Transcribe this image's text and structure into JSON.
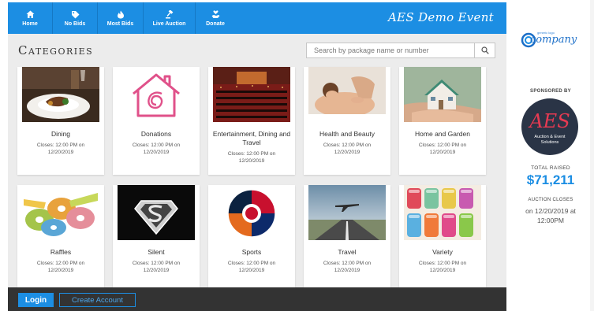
{
  "nav": {
    "items": [
      {
        "label": "Home",
        "icon": "home-icon"
      },
      {
        "label": "No Bids",
        "icon": "tag-icon"
      },
      {
        "label": "Most Bids",
        "icon": "fire-icon"
      },
      {
        "label": "Live Auction",
        "icon": "gavel-icon"
      },
      {
        "label": "Donate",
        "icon": "heart-hand-icon"
      }
    ],
    "event_title": "AES Demo Event"
  },
  "header": {
    "title": "Categories",
    "search_placeholder": "Search by package name or number"
  },
  "categories": [
    {
      "name": "Dining",
      "closes": "Closes: 12:00 PM on 12/20/2019"
    },
    {
      "name": "Donations",
      "closes": "Closes: 12:00 PM on 12/20/2019"
    },
    {
      "name": "Entertainment, Dining and Travel",
      "closes": "Closes: 12:00 PM on 12/20/2019"
    },
    {
      "name": "Health and Beauty",
      "closes": "Closes: 12:00 PM on 12/20/2019"
    },
    {
      "name": "Home and Garden",
      "closes": "Closes: 12:00 PM on 12/20/2019"
    },
    {
      "name": "Raffles",
      "closes": "Closes: 12:00 PM on 12/20/2019"
    },
    {
      "name": "Silent",
      "closes": "Closes: 12:00 PM on 12/20/2019"
    },
    {
      "name": "Sports",
      "closes": "Closes: 12:00 PM on 12/20/2019"
    },
    {
      "name": "Travel",
      "closes": "Closes: 12:00 PM on 12/20/2019"
    },
    {
      "name": "Variety",
      "closes": "Closes: 12:00 PM on 12/20/2019"
    }
  ],
  "footer": {
    "login_label": "Login",
    "create_label": "Create Account"
  },
  "sidebar": {
    "logo_tagline": "generic logo",
    "logo_word": "company",
    "sponsored_label": "SPONSORED BY",
    "sponsor_initials": "AES",
    "sponsor_name_line1": "Auction & Event",
    "sponsor_name_line2": "Solutions",
    "raised_label": "TOTAL RAISED",
    "raised_value": "$71,211",
    "closes_label": "AUCTION CLOSES",
    "closes_value": "on 12/20/2019 at 12:00PM"
  },
  "colors": {
    "brand_blue": "#1c8ee3",
    "dark_bar": "#333333",
    "panel_bg": "#ececec"
  }
}
